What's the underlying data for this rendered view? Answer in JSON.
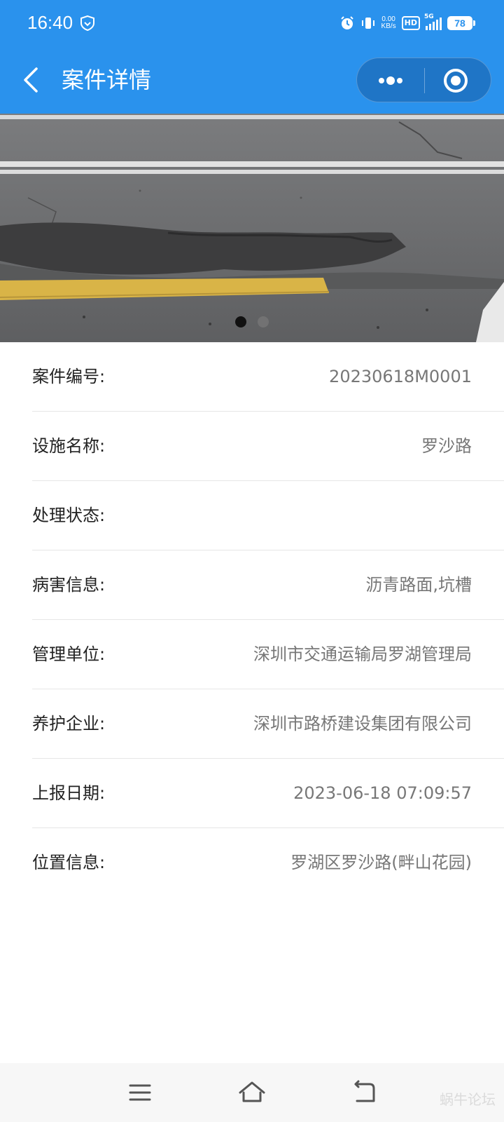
{
  "status_bar": {
    "time": "16:40",
    "net_speed_value": "0.00",
    "net_speed_unit": "KB/s",
    "hd": "HD",
    "network": "5G",
    "battery": "78"
  },
  "nav": {
    "title": "案件详情"
  },
  "banner": {
    "slide_count": 2,
    "active_index": 0
  },
  "details": [
    {
      "label": "案件编号:",
      "value": "20230618M0001"
    },
    {
      "label": "设施名称:",
      "value": "罗沙路"
    },
    {
      "label": "处理状态:",
      "value": ""
    },
    {
      "label": "病害信息:",
      "value": "沥青路面,坑槽"
    },
    {
      "label": "管理单位:",
      "value": "深圳市交通运输局罗湖管理局"
    },
    {
      "label": "养护企业:",
      "value": "深圳市路桥建设集团有限公司"
    },
    {
      "label": "上报日期:",
      "value": "2023-06-18 07:09:57"
    },
    {
      "label": "位置信息:",
      "value": "罗湖区罗沙路(畔山花园)"
    }
  ],
  "watermark": "蜗牛论坛",
  "colors": {
    "primary": "#2a92ed",
    "capsule": "#1f75c6",
    "label": "#222222",
    "value": "#777777",
    "divider": "#e6e6e6"
  }
}
